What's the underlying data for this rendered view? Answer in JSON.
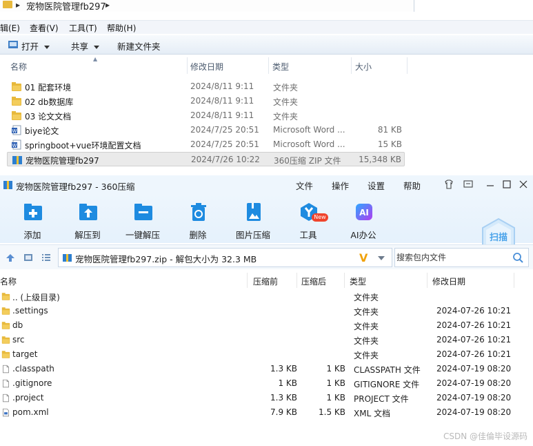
{
  "explorer": {
    "breadcrumb": "宠物医院管理fb297",
    "menu": [
      "辑(E)",
      "查看(V)",
      "工具(T)",
      "帮助(H)"
    ],
    "toolbar": {
      "open": "打开",
      "share": "共享",
      "new_folder": "新建文件夹"
    },
    "columns": {
      "name": "名称",
      "date": "修改日期",
      "type": "类型",
      "size": "大小"
    },
    "files": [
      {
        "name": "01 配套环境",
        "date": "2024/8/11 9:11",
        "type": "文件夹",
        "size": "",
        "icon": "folder-icon"
      },
      {
        "name": "02 db数据库",
        "date": "2024/8/11 9:11",
        "type": "文件夹",
        "size": "",
        "icon": "folder-icon"
      },
      {
        "name": "03 论文文档",
        "date": "2024/8/11 9:11",
        "type": "文件夹",
        "size": "",
        "icon": "folder-icon"
      },
      {
        "name": "biye论文",
        "date": "2024/7/25 20:51",
        "type": "Microsoft Word ...",
        "size": "81 KB",
        "icon": "word-doc-icon"
      },
      {
        "name": "springboot+vue环境配置文档",
        "date": "2024/7/25 20:51",
        "type": "Microsoft Word ...",
        "size": "15 KB",
        "icon": "word-doc-icon"
      },
      {
        "name": "宠物医院管理fb297",
        "date": "2024/7/26 10:22",
        "type": "360压缩 ZIP 文件",
        "size": "15,348 KB",
        "icon": "zip-archive-icon"
      }
    ]
  },
  "zip": {
    "title": "宠物医院管理fb297 - 360压缩",
    "menu": [
      "文件",
      "操作",
      "设置",
      "帮助"
    ],
    "tools": [
      {
        "label": "添加",
        "icon": "add-archive-icon"
      },
      {
        "label": "解压到",
        "icon": "extract-to-icon"
      },
      {
        "label": "一键解压",
        "icon": "one-click-extract-icon"
      },
      {
        "label": "删除",
        "icon": "trash-icon"
      },
      {
        "label": "图片压缩",
        "icon": "image-compress-icon"
      },
      {
        "label": "工具",
        "icon": "tools-icon"
      },
      {
        "label": "AI办公",
        "icon": "ai-office-icon"
      }
    ],
    "new_badge": "New",
    "scan_label": "扫描",
    "path": "宠物医院管理fb297.zip - 解包大小为 32.3 MB",
    "search_placeholder": "搜索包内文件",
    "columns": {
      "name": "名称",
      "packed": "压缩前",
      "compressed": "压缩后",
      "type": "类型",
      "modified": "修改日期"
    },
    "files": [
      {
        "name": ".. (上级目录)",
        "packed": "",
        "compressed": "",
        "type": "文件夹",
        "modified": "",
        "icon": "folder-icon"
      },
      {
        "name": ".settings",
        "packed": "",
        "compressed": "",
        "type": "文件夹",
        "modified": "2024-07-26 10:21",
        "icon": "folder-icon"
      },
      {
        "name": "db",
        "packed": "",
        "compressed": "",
        "type": "文件夹",
        "modified": "2024-07-26 10:21",
        "icon": "folder-icon"
      },
      {
        "name": "src",
        "packed": "",
        "compressed": "",
        "type": "文件夹",
        "modified": "2024-07-26 10:21",
        "icon": "folder-icon"
      },
      {
        "name": "target",
        "packed": "",
        "compressed": "",
        "type": "文件夹",
        "modified": "2024-07-26 10:21",
        "icon": "folder-icon"
      },
      {
        "name": ".classpath",
        "packed": "1.3 KB",
        "compressed": "1 KB",
        "type": "CLASSPATH 文件",
        "modified": "2024-07-19 08:20",
        "icon": "file-icon"
      },
      {
        "name": ".gitignore",
        "packed": "1 KB",
        "compressed": "1 KB",
        "type": "GITIGNORE 文件",
        "modified": "2024-07-19 08:20",
        "icon": "file-icon"
      },
      {
        "name": ".project",
        "packed": "1.3 KB",
        "compressed": "1 KB",
        "type": "PROJECT 文件",
        "modified": "2024-07-19 08:20",
        "icon": "file-icon"
      },
      {
        "name": "pom.xml",
        "packed": "7.9 KB",
        "compressed": "1.5 KB",
        "type": "XML 文档",
        "modified": "2024-07-19 08:20",
        "icon": "xml-file-icon"
      }
    ]
  },
  "watermark": "CSDN @佳倫毕设源码",
  "colors": {
    "folder": "#e8b93c",
    "accent": "#1a8fe3",
    "ai": "#9b3cf0",
    "badge": "#f0442c"
  }
}
